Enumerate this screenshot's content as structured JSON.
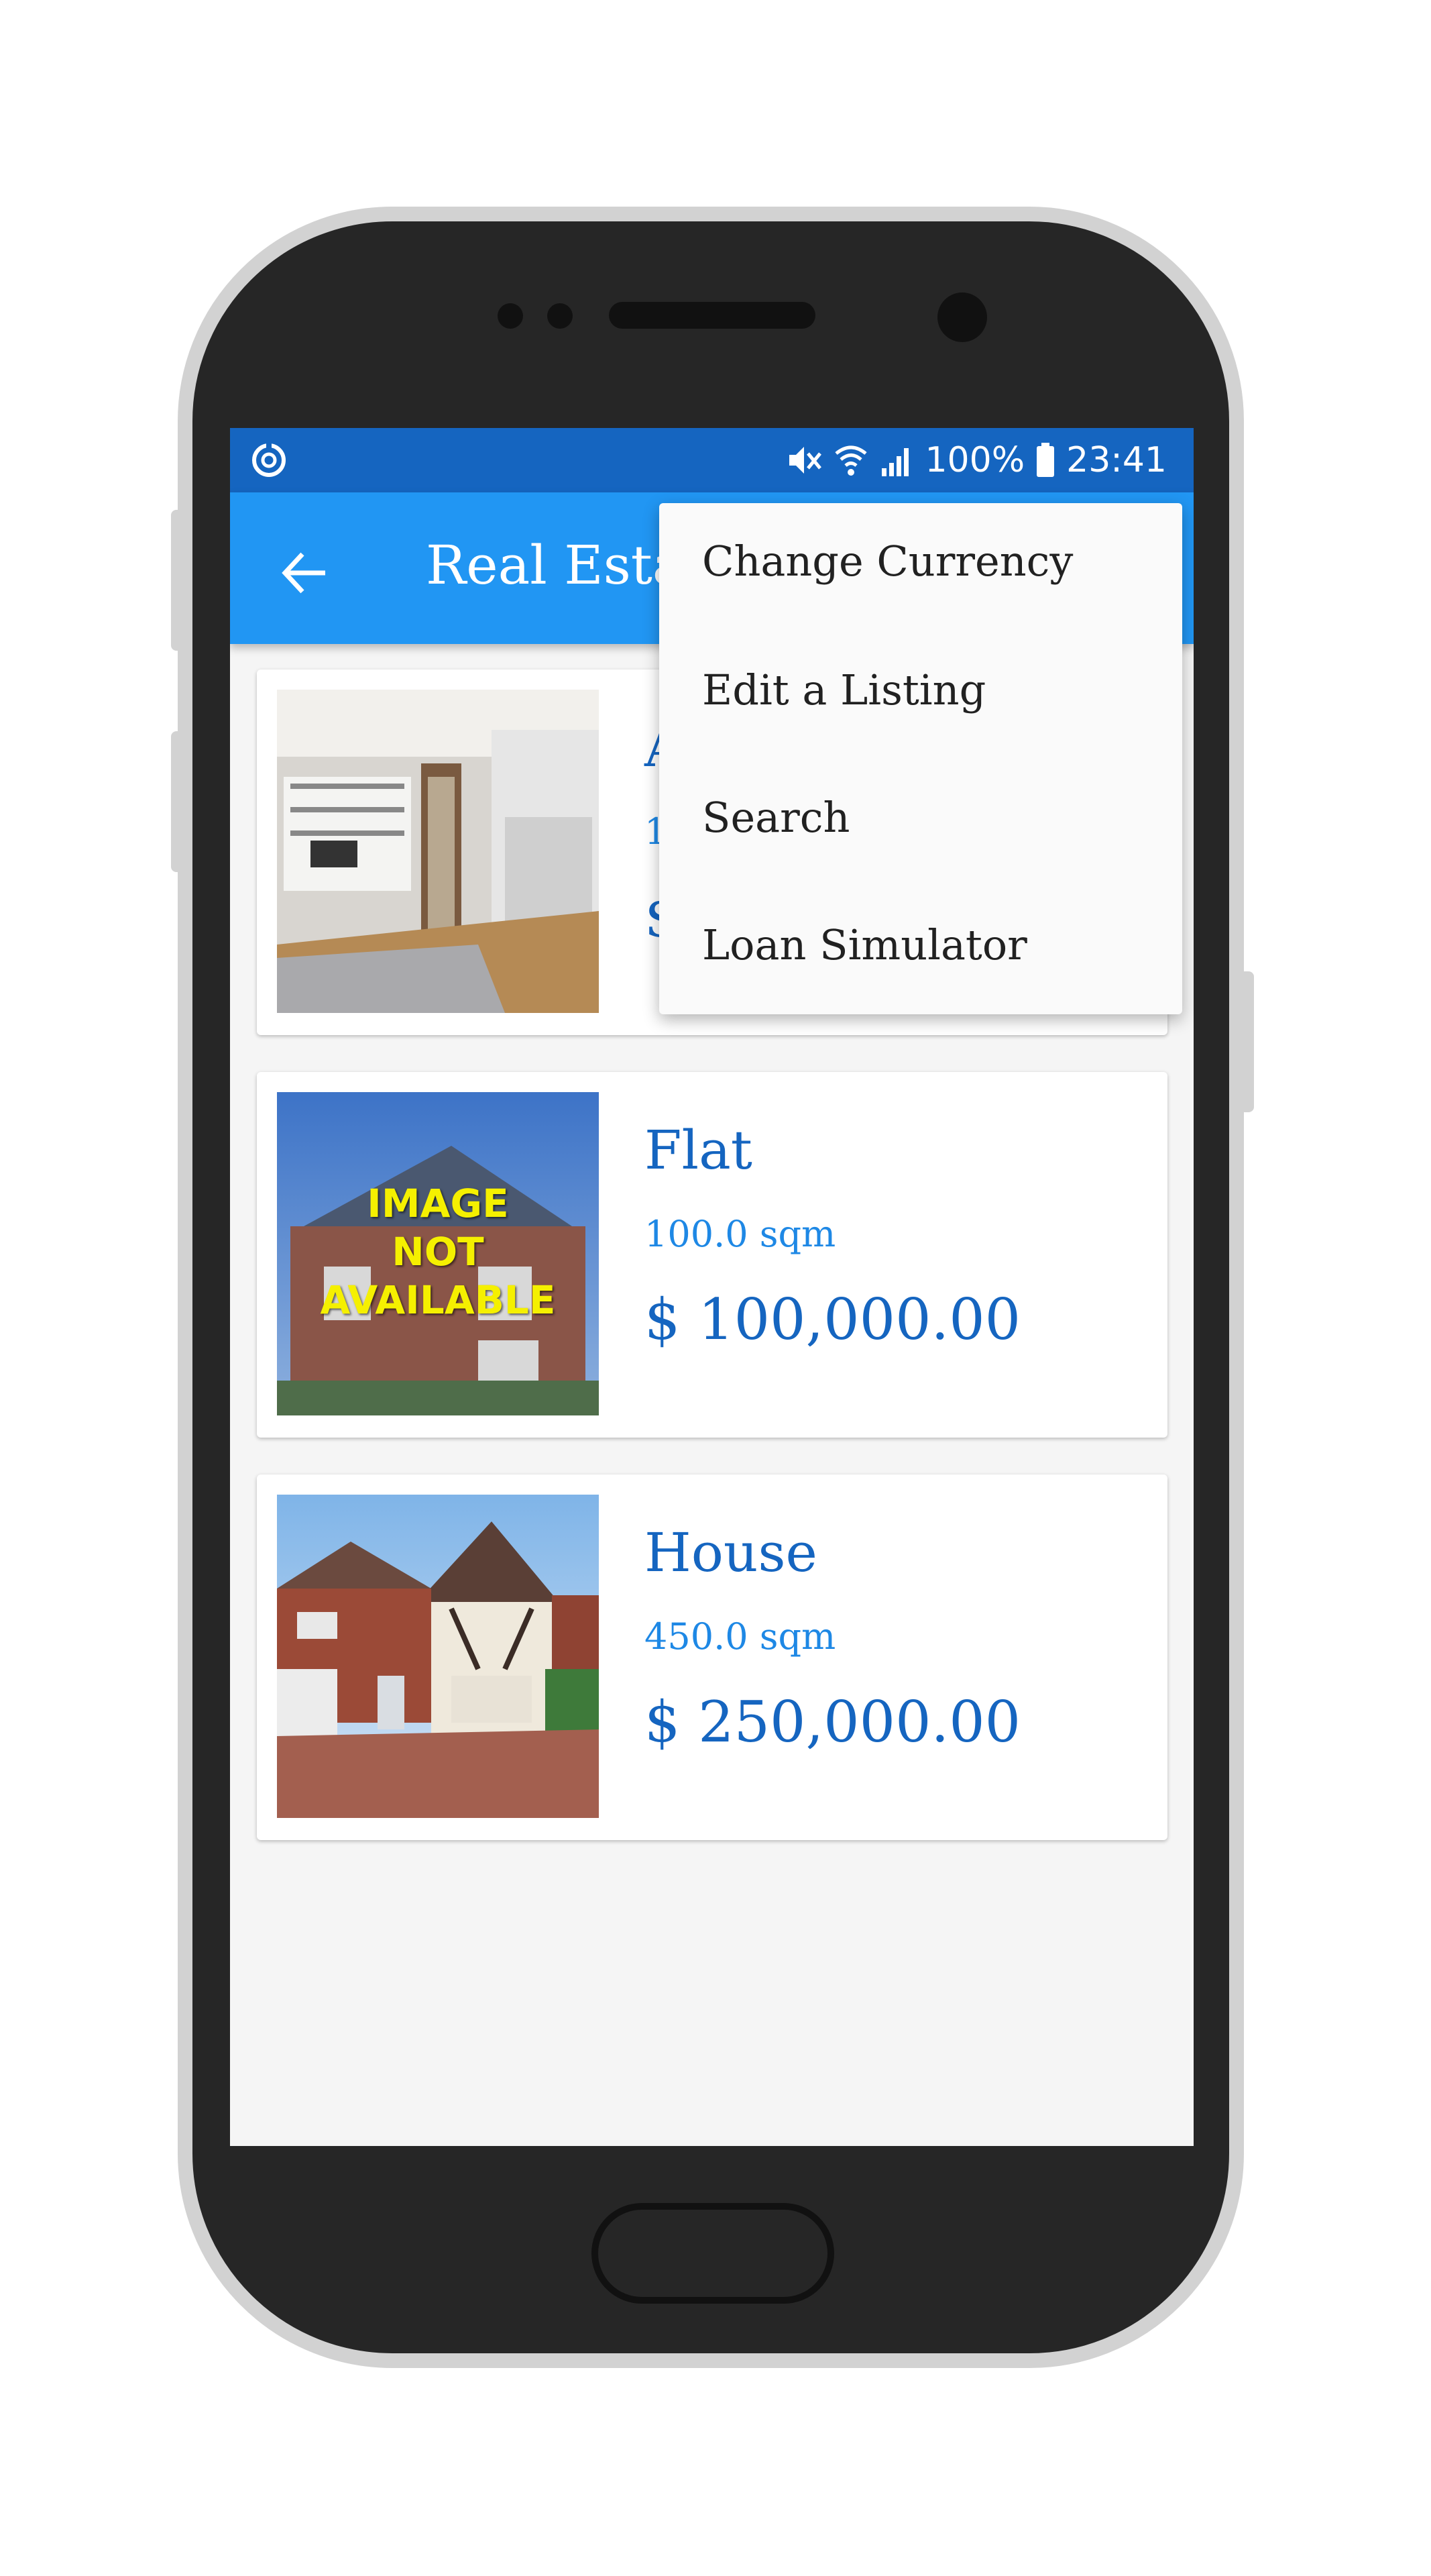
{
  "status_bar": {
    "battery": "100%",
    "time": "23:41",
    "icons": [
      "sync-icon",
      "mute-icon",
      "wifi-icon",
      "signal-icon",
      "battery-icon"
    ]
  },
  "app_bar": {
    "title": "Real Estat",
    "back_icon": "arrow-left-icon"
  },
  "overflow_menu": {
    "items": [
      {
        "label": "Change Currency"
      },
      {
        "label": "Edit a Listing"
      },
      {
        "label": "Search"
      },
      {
        "label": "Loan Simulator"
      }
    ]
  },
  "listings": [
    {
      "title": "A",
      "area": "1",
      "price": "$",
      "image": "apartment-interior"
    },
    {
      "title": "Flat",
      "area": "100.0 sqm",
      "price": "$ 100,000.00",
      "image": "image-not-available",
      "image_text": [
        "IMAGE",
        "NOT",
        "AVAILABLE"
      ]
    },
    {
      "title": "House",
      "area": "450.0 sqm",
      "price": "$ 250,000.00",
      "image": "house-exterior"
    }
  ],
  "colors": {
    "status_bar": "#1565c0",
    "app_bar": "#2196f3",
    "accent_text": "#1565c0",
    "area_text": "#1e88e5"
  }
}
